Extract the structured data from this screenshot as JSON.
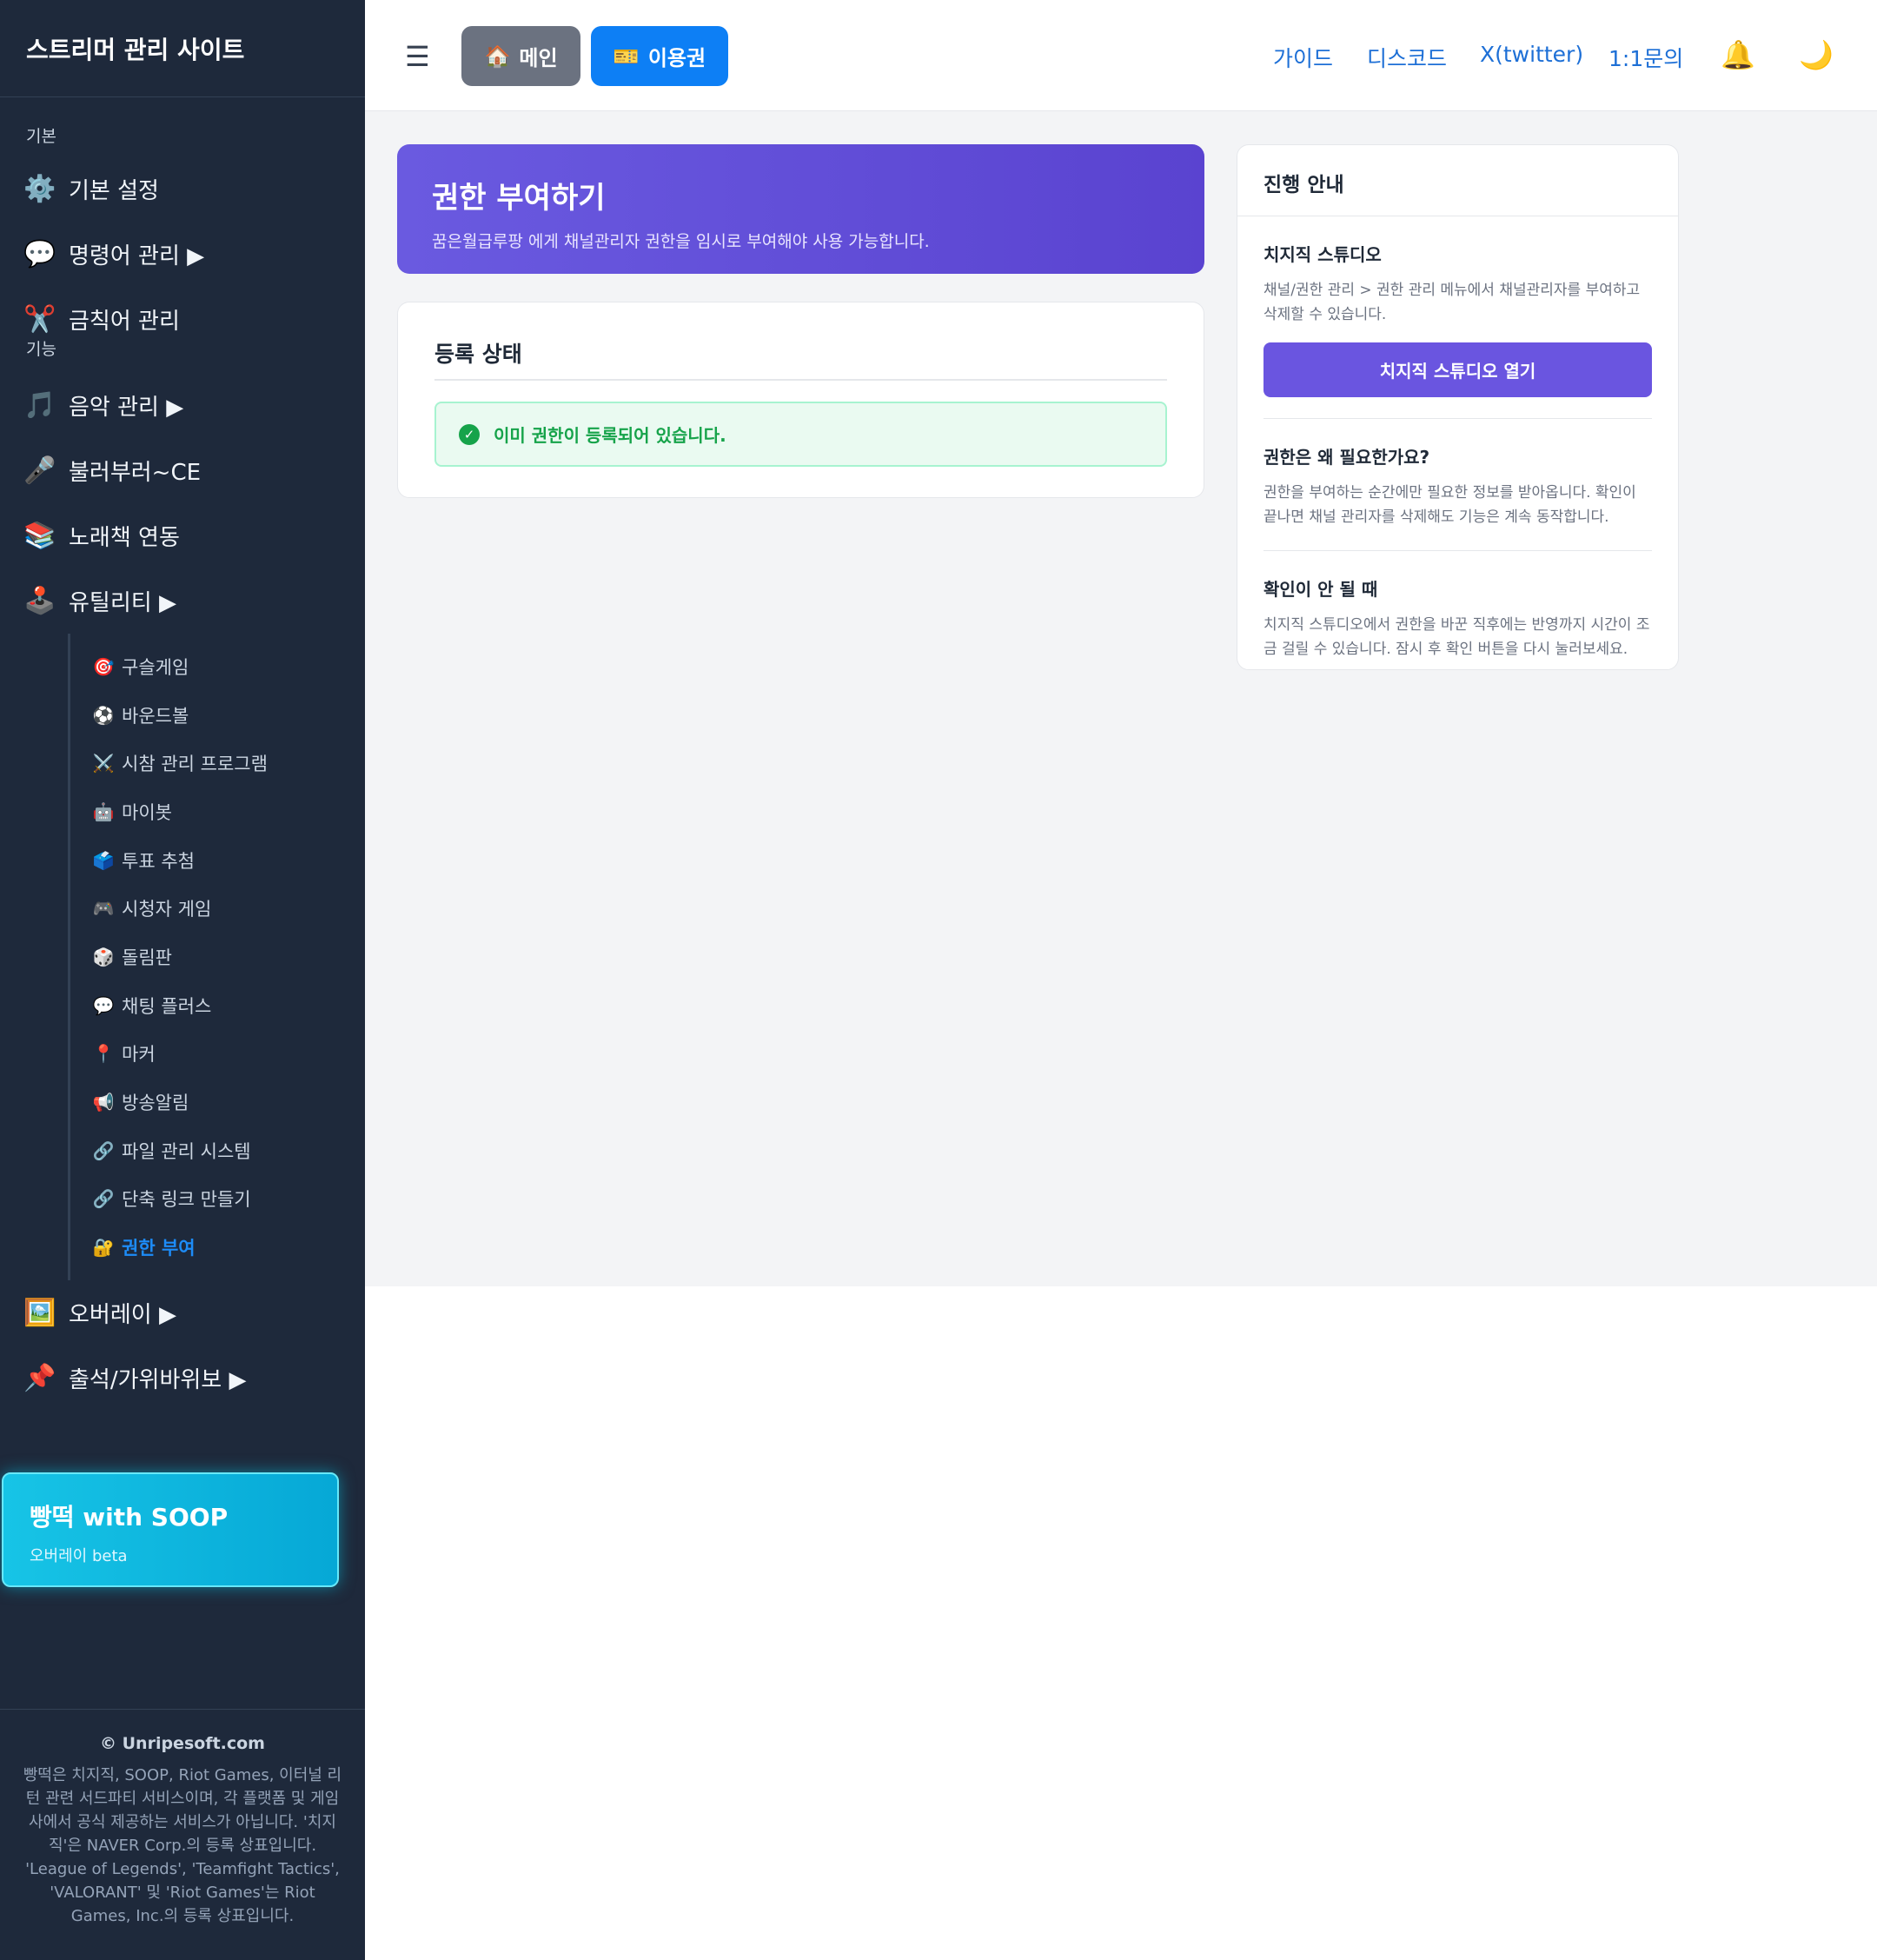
{
  "sidebar": {
    "brand": "스트리머 관리 사이트",
    "section_basic": "기본",
    "section_feature": "기능",
    "basic_items": [
      {
        "icon": "⚙️",
        "label": "기본 설정"
      },
      {
        "icon": "💬",
        "label": "명령어 관리 ▶"
      },
      {
        "icon": "✂️",
        "label": "금칙어 관리"
      }
    ],
    "feature_items": [
      {
        "icon": "🎵",
        "label": "음악 관리 ▶"
      },
      {
        "icon": "🎤",
        "label": "불러부러~CE"
      },
      {
        "icon": "📚",
        "label": "노래책 연동"
      },
      {
        "icon": "🕹️",
        "label": "유틸리티 ▶"
      }
    ],
    "utility_items": [
      {
        "icon": "🎯",
        "label": "구슬게임"
      },
      {
        "icon": "⚽",
        "label": "바운드볼"
      },
      {
        "icon": "⚔️",
        "label": "시참 관리 프로그램"
      },
      {
        "icon": "🤖",
        "label": "마이봇"
      },
      {
        "icon": "🗳️",
        "label": "투표 추첨"
      },
      {
        "icon": "🎮",
        "label": "시청자 게임"
      },
      {
        "icon": "🎲",
        "label": "돌림판"
      },
      {
        "icon": "💬",
        "label": "채팅 플러스"
      },
      {
        "icon": "📍",
        "label": "마커"
      },
      {
        "icon": "📢",
        "label": "방송알림"
      },
      {
        "icon": "🔗",
        "label": "파일 관리 시스템"
      },
      {
        "icon": "🔗",
        "label": "단축 링크 만들기"
      },
      {
        "icon": "🔐",
        "label": "권한 부여"
      }
    ],
    "after_items": [
      {
        "icon": "🖼️",
        "label": "오버레이 ▶"
      },
      {
        "icon": "📌",
        "label": "출석/가위바위보 ▶"
      }
    ],
    "soop": {
      "title": "빵떡 with SOOP",
      "subtitle": "오버레이 beta"
    },
    "footer": {
      "copyright": "© Unripesoft.com",
      "legal": "빵떡은 치지직, SOOP, Riot Games, 이터널 리턴 관련 서드파티 서비스이며, 각 플랫폼 및 게임사에서 공식 제공하는 서비스가 아닙니다. '치지직'은 NAVER Corp.의 등록 상표입니다. 'League of Legends', 'Teamfight Tactics', 'VALORANT' 및 'Riot Games'는 Riot Games, Inc.의 등록 상표입니다."
    }
  },
  "topbar": {
    "menu_icon": "☰",
    "main_button": {
      "icon": "🏠",
      "label": "메인"
    },
    "ticket_button": {
      "icon": "🎫",
      "label": "이용권"
    },
    "links": [
      "가이드",
      "디스코드",
      "X(twitter)",
      "1:1문의"
    ],
    "bell_icon": "🔔",
    "theme_icon": "🌙"
  },
  "hero": {
    "title": "권한 부여하기",
    "description": "꿈은월급루팡 에게 채널관리자 권한을 임시로 부여해야 사용 가능합니다."
  },
  "status": {
    "title": "등록 상태",
    "message": "이미 권한이 등록되어 있습니다."
  },
  "guide": {
    "title": "진행 안내",
    "sections": [
      {
        "title": "치지직 스튜디오",
        "text": "채널/권한 관리 > 권한 관리 메뉴에서 채널관리자를 부여하고 삭제할 수 있습니다.",
        "button": "치지직 스튜디오 열기"
      },
      {
        "title": "권한은 왜 필요한가요?",
        "text": "권한을 부여하는 순간에만 필요한 정보를 받아옵니다. 확인이 끝나면 채널 관리자를 삭제해도 기능은 계속 동작합니다."
      },
      {
        "title": "확인이 안 될 때",
        "text": "치지직 스튜디오에서 권한을 바꾼 직후에는 반영까지 시간이 조금 걸릴 수 있습니다. 잠시 후 확인 버튼을 다시 눌러보세요."
      }
    ]
  },
  "colors": {
    "sidebar_bg": "#1e293b",
    "accent_purple": "#6a55e0",
    "accent_blue": "#0d7ff5",
    "success_green": "#16a34a",
    "soop_cyan": "#17c4e6"
  }
}
